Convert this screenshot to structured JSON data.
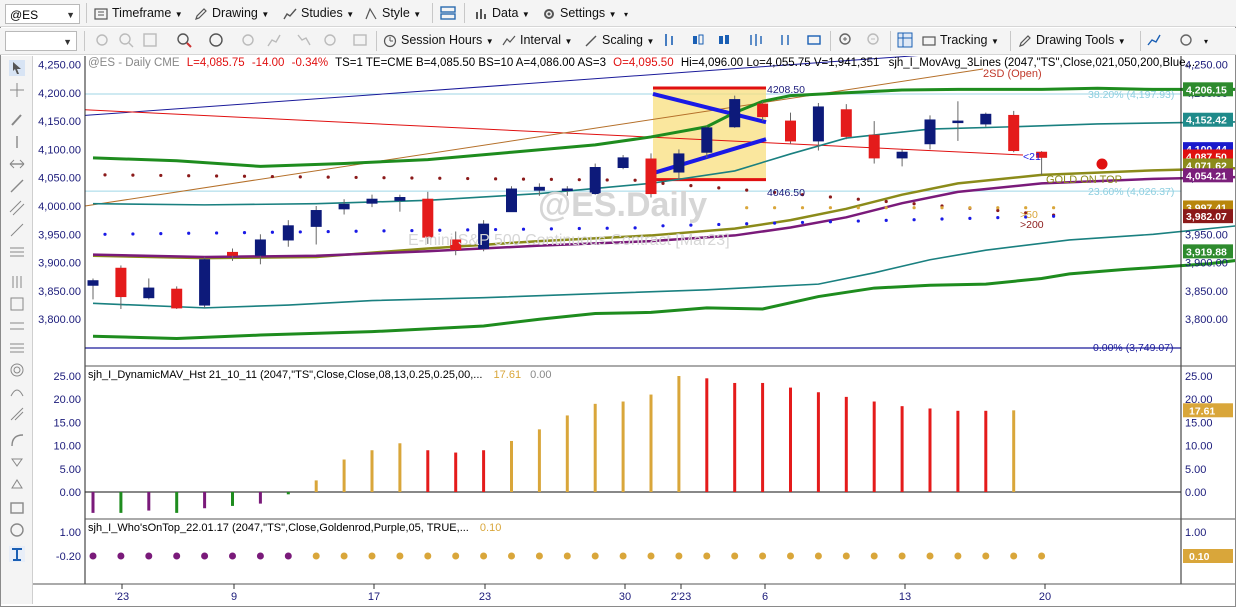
{
  "toolbar1": {
    "symbol": "@ES",
    "timeframe": "Timeframe",
    "drawing": "Drawing",
    "studies": "Studies",
    "style": "Style",
    "data": "Data",
    "settings": "Settings"
  },
  "toolbar2": {
    "session_hours": "Session Hours",
    "interval": "Interval",
    "scaling": "Scaling",
    "tracking": "Tracking",
    "drawing_tools": "Drawing Tools"
  },
  "header": {
    "symbol_info": "@ES - Daily  CME",
    "last": "L=4,085.75",
    "change": "-14.00",
    "pct": "-0.34%",
    "meta": "TS=1  TE=CME  B=4,085.50  BS=10  A=4,086.00  AS=3",
    "open": "O=4,095.50",
    "hilo": "Hi=4,096.00   Lo=4,055.75  V=1,941,351",
    "study": "sjh_I_MovAvg_3Lines (2047,\"TS\",Close,021,050,200,Blue,..."
  },
  "watermark": {
    "symbol": "@ES.Daily",
    "desc": "E-mini S&P 500 Continuous Contract [Mar23]"
  },
  "annotations": {
    "sd": "2SD (Open)",
    "fib382": "38.20% (4,197.93)",
    "fib236": "23.60% (4,026.37)",
    "fib0": "0.00% (3,749.07)",
    "box_top": "4208.50",
    "box_bottom": "4046.50",
    "gold": "GOLD ON TOP",
    "ma21": "<21",
    "ma50": ">50",
    "ma200": ">200"
  },
  "price_axis": {
    "ticks": [
      "4,250.00",
      "4,200.00",
      "4,150.00",
      "4,100.00",
      "4,050.00",
      "4,000.00",
      "3,950.00",
      "3,900.00",
      "3,850.00",
      "3,800.00"
    ],
    "badges": [
      {
        "text": "4,206.15",
        "color": "#2e8b2e"
      },
      {
        "text": "4,152.42",
        "color": "#1f8a8a"
      },
      {
        "text": "4,100.44",
        "color": "#1a1acc"
      },
      {
        "text": "4,087.50",
        "color": "#e01010"
      },
      {
        "text": "4,071.62",
        "color": "#8b8b1a"
      },
      {
        "text": "4,054.21",
        "color": "#7b1f7b"
      },
      {
        "text": "3,997.41",
        "color": "#b8860b"
      },
      {
        "text": "3,982.07",
        "color": "#8b1a1a"
      },
      {
        "text": "3,919.88",
        "color": "#2e8b2e"
      }
    ]
  },
  "sub1": {
    "title": "sjh_I_DynamicMAV_Hst 21_10_11 (2047,\"TS\",Close,Close,08,13,0.25,0.25,00,...",
    "v1": "17.61",
    "v2": "0.00",
    "ticks": [
      "25.00",
      "20.00",
      "15.00",
      "10.00",
      "5.00",
      "0.00"
    ],
    "badge": "17.61"
  },
  "sub2": {
    "title": "sjh_I_Who'sOnTop_22.01.17 (2047,\"TS\",Close,Goldenrod,Purple,05, TRUE,...",
    "v1": "0.10",
    "ticks": [
      "1.00",
      "-0.20"
    ],
    "badge": "0.10"
  },
  "time_axis": [
    "'23",
    "9",
    "17",
    "23",
    "30",
    "2'23",
    "6",
    "13",
    "20"
  ],
  "colors": {
    "up": "#0d1a7a",
    "down": "#e41b1b",
    "green": "#1e8c1e",
    "teal": "#1a8080",
    "olive": "#8b8b1a",
    "purple": "#7a1a7a",
    "gold": "#d9a63a",
    "blue": "#1a1ae6"
  },
  "chart_data": {
    "type": "candlestick",
    "candles": [
      {
        "o": 3860,
        "h": 3872,
        "l": 3835,
        "c": 3868
      },
      {
        "o": 3890,
        "h": 3895,
        "l": 3818,
        "c": 3840
      },
      {
        "o": 3838,
        "h": 3872,
        "l": 3835,
        "c": 3855
      },
      {
        "o": 3853,
        "h": 3858,
        "l": 3818,
        "c": 3820
      },
      {
        "o": 3825,
        "h": 3910,
        "l": 3820,
        "c": 3905
      },
      {
        "o": 3918,
        "h": 3925,
        "l": 3903,
        "c": 3913
      },
      {
        "o": 3913,
        "h": 3950,
        "l": 3897,
        "c": 3940
      },
      {
        "o": 3940,
        "h": 3975,
        "l": 3928,
        "c": 3965
      },
      {
        "o": 3964,
        "h": 4000,
        "l": 3932,
        "c": 3992
      },
      {
        "o": 3995,
        "h": 4012,
        "l": 3985,
        "c": 4003
      },
      {
        "o": 4005,
        "h": 4020,
        "l": 3998,
        "c": 4012
      },
      {
        "o": 4010,
        "h": 4020,
        "l": 3990,
        "c": 4015
      },
      {
        "o": 4012,
        "h": 4025,
        "l": 3933,
        "c": 3945
      },
      {
        "o": 3940,
        "h": 3955,
        "l": 3913,
        "c": 3923
      },
      {
        "o": 3925,
        "h": 3975,
        "l": 3920,
        "c": 3968
      },
      {
        "o": 3990,
        "h": 4035,
        "l": 3990,
        "c": 4030
      },
      {
        "o": 4028,
        "h": 4040,
        "l": 4018,
        "c": 4033
      },
      {
        "o": 4030,
        "h": 4035,
        "l": 4018,
        "c": 4030
      },
      {
        "o": 4022,
        "h": 4075,
        "l": 4020,
        "c": 4068
      },
      {
        "o": 4068,
        "h": 4090,
        "l": 4065,
        "c": 4085
      },
      {
        "o": 4083,
        "h": 4093,
        "l": 4015,
        "c": 4022
      },
      {
        "o": 4060,
        "h": 4100,
        "l": 4045,
        "c": 4092
      },
      {
        "o": 4095,
        "h": 4142,
        "l": 4085,
        "c": 4138
      },
      {
        "o": 4140,
        "h": 4195,
        "l": 4138,
        "c": 4188
      },
      {
        "o": 4180,
        "h": 4185,
        "l": 4150,
        "c": 4158
      },
      {
        "o": 4150,
        "h": 4165,
        "l": 4110,
        "c": 4115
      },
      {
        "o": 4115,
        "h": 4182,
        "l": 4098,
        "c": 4175
      },
      {
        "o": 4170,
        "h": 4180,
        "l": 4118,
        "c": 4123
      },
      {
        "o": 4125,
        "h": 4150,
        "l": 4075,
        "c": 4085
      },
      {
        "o": 4085,
        "h": 4100,
        "l": 4070,
        "c": 4095
      },
      {
        "o": 4110,
        "h": 4160,
        "l": 4100,
        "c": 4152
      },
      {
        "o": 4148,
        "h": 4185,
        "l": 4115,
        "c": 4150
      },
      {
        "o": 4145,
        "h": 4165,
        "l": 4140,
        "c": 4162
      },
      {
        "o": 4160,
        "h": 4168,
        "l": 4095,
        "c": 4098
      },
      {
        "o": 4095,
        "h": 4097,
        "l": 4055,
        "c": 4086
      }
    ],
    "hist": [
      -4.5,
      -4.5,
      -4.0,
      -4.5,
      -3.5,
      -3.0,
      -2.5,
      -0.5,
      2.5,
      7.0,
      9.0,
      10.5,
      9.0,
      8.5,
      9.0,
      11.0,
      13.5,
      16.5,
      19.0,
      19.5,
      21.0,
      25.0,
      24.5,
      23.5,
      23.5,
      22.5,
      21.5,
      20.5,
      19.5,
      18.5,
      18.0,
      17.5,
      17.5,
      17.6
    ],
    "ylim": [
      3735,
      4265
    ]
  }
}
